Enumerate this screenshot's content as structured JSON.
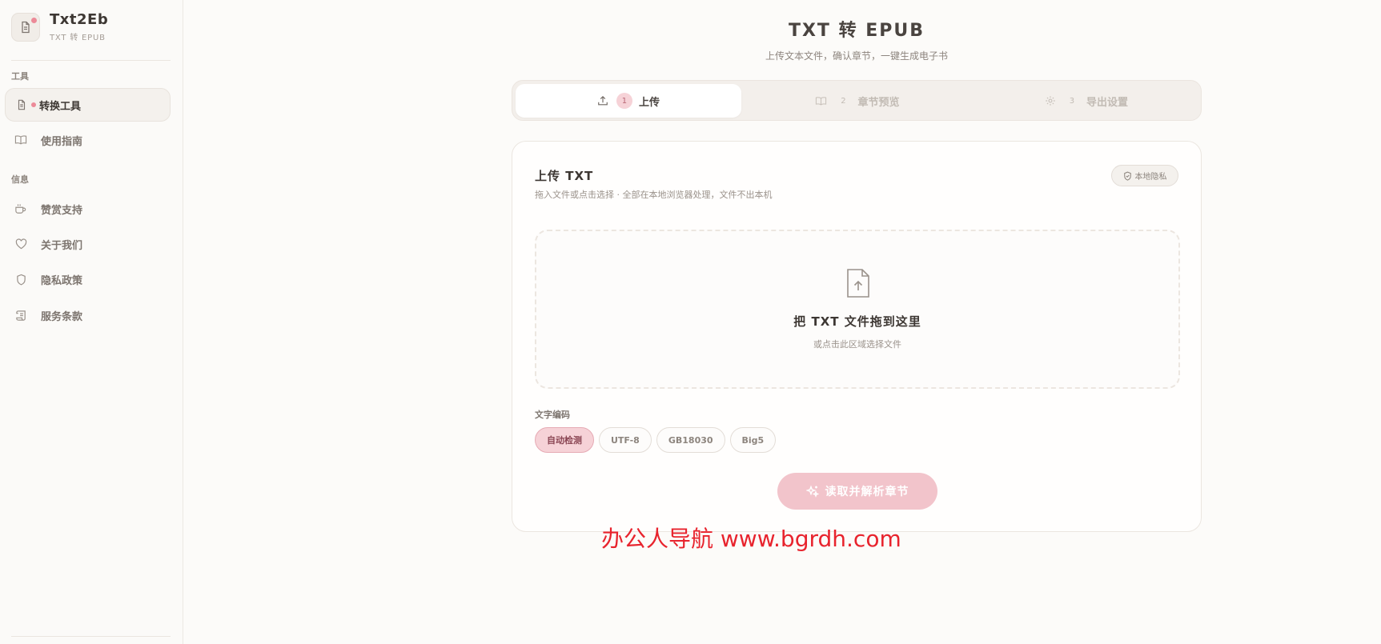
{
  "sidebar": {
    "brand": {
      "title": "Txt2Eb",
      "subtitle": "TXT 转 EPUB"
    },
    "sections": [
      {
        "label": "工具"
      },
      {
        "label": "信息"
      }
    ],
    "items": [
      {
        "label": "转换工具",
        "icon": "document-icon",
        "active": true
      },
      {
        "label": "使用指南",
        "icon": "book-icon"
      },
      {
        "label": "赞赏支持",
        "icon": "coffee-icon"
      },
      {
        "label": "关于我们",
        "icon": "heart-icon"
      },
      {
        "label": "隐私政策",
        "icon": "shield-icon"
      },
      {
        "label": "服务条款",
        "icon": "scroll-icon"
      }
    ]
  },
  "header": {
    "title": "TXT 转 EPUB",
    "subtitle": "上传文本文件，确认章节，一键生成电子书"
  },
  "steps": [
    {
      "num": "1",
      "label": "上传",
      "icon": "upload-icon",
      "active": true
    },
    {
      "num": "2",
      "label": "章节预览",
      "icon": "book-icon"
    },
    {
      "num": "3",
      "label": "导出设置",
      "icon": "gear-icon"
    }
  ],
  "card": {
    "title": "上传 TXT",
    "desc": "拖入文件或点击选择 · 全部在本地浏览器处理，文件不出本机",
    "privacy_badge": "本地隐私",
    "dropzone": {
      "title": "把 TXT 文件拖到这里",
      "hint": "或点击此区域选择文件"
    },
    "encoding": {
      "label": "文字编码",
      "options": [
        "自动检测",
        "UTF-8",
        "GB18030",
        "Big5"
      ],
      "selected": "自动检测"
    },
    "parse_button": "读取并解析章节"
  },
  "watermark": "办公人导航  www.bgrdh.com",
  "colors": {
    "accent": "#ec8a98",
    "accent_soft": "#f6d2d7",
    "button": "#f2c4cb",
    "watermark": "#e8232d"
  }
}
